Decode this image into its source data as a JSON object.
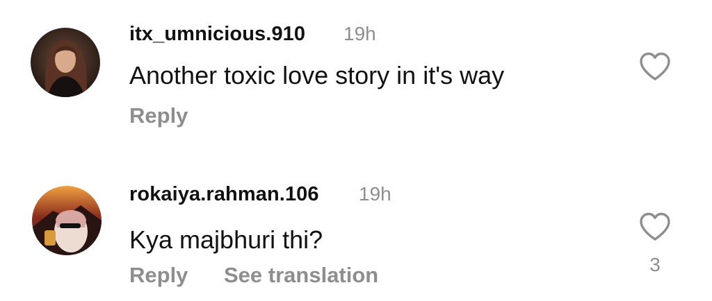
{
  "comments": [
    {
      "username": "itx_umnicious.910",
      "time": "19h",
      "text": "Another toxic love story in it's way",
      "reply_label": "Reply",
      "like_count": ""
    },
    {
      "username": "rokaiya.rahman.106",
      "time": "19h",
      "text": "Kya majbhuri thi?",
      "reply_label": "Reply",
      "translate_label": "See translation",
      "like_count": "3"
    }
  ],
  "icons": {
    "like": "heart-outline-icon"
  },
  "colors": {
    "text": "#111111",
    "secondary": "#8e8e8e",
    "background": "#ffffff"
  }
}
